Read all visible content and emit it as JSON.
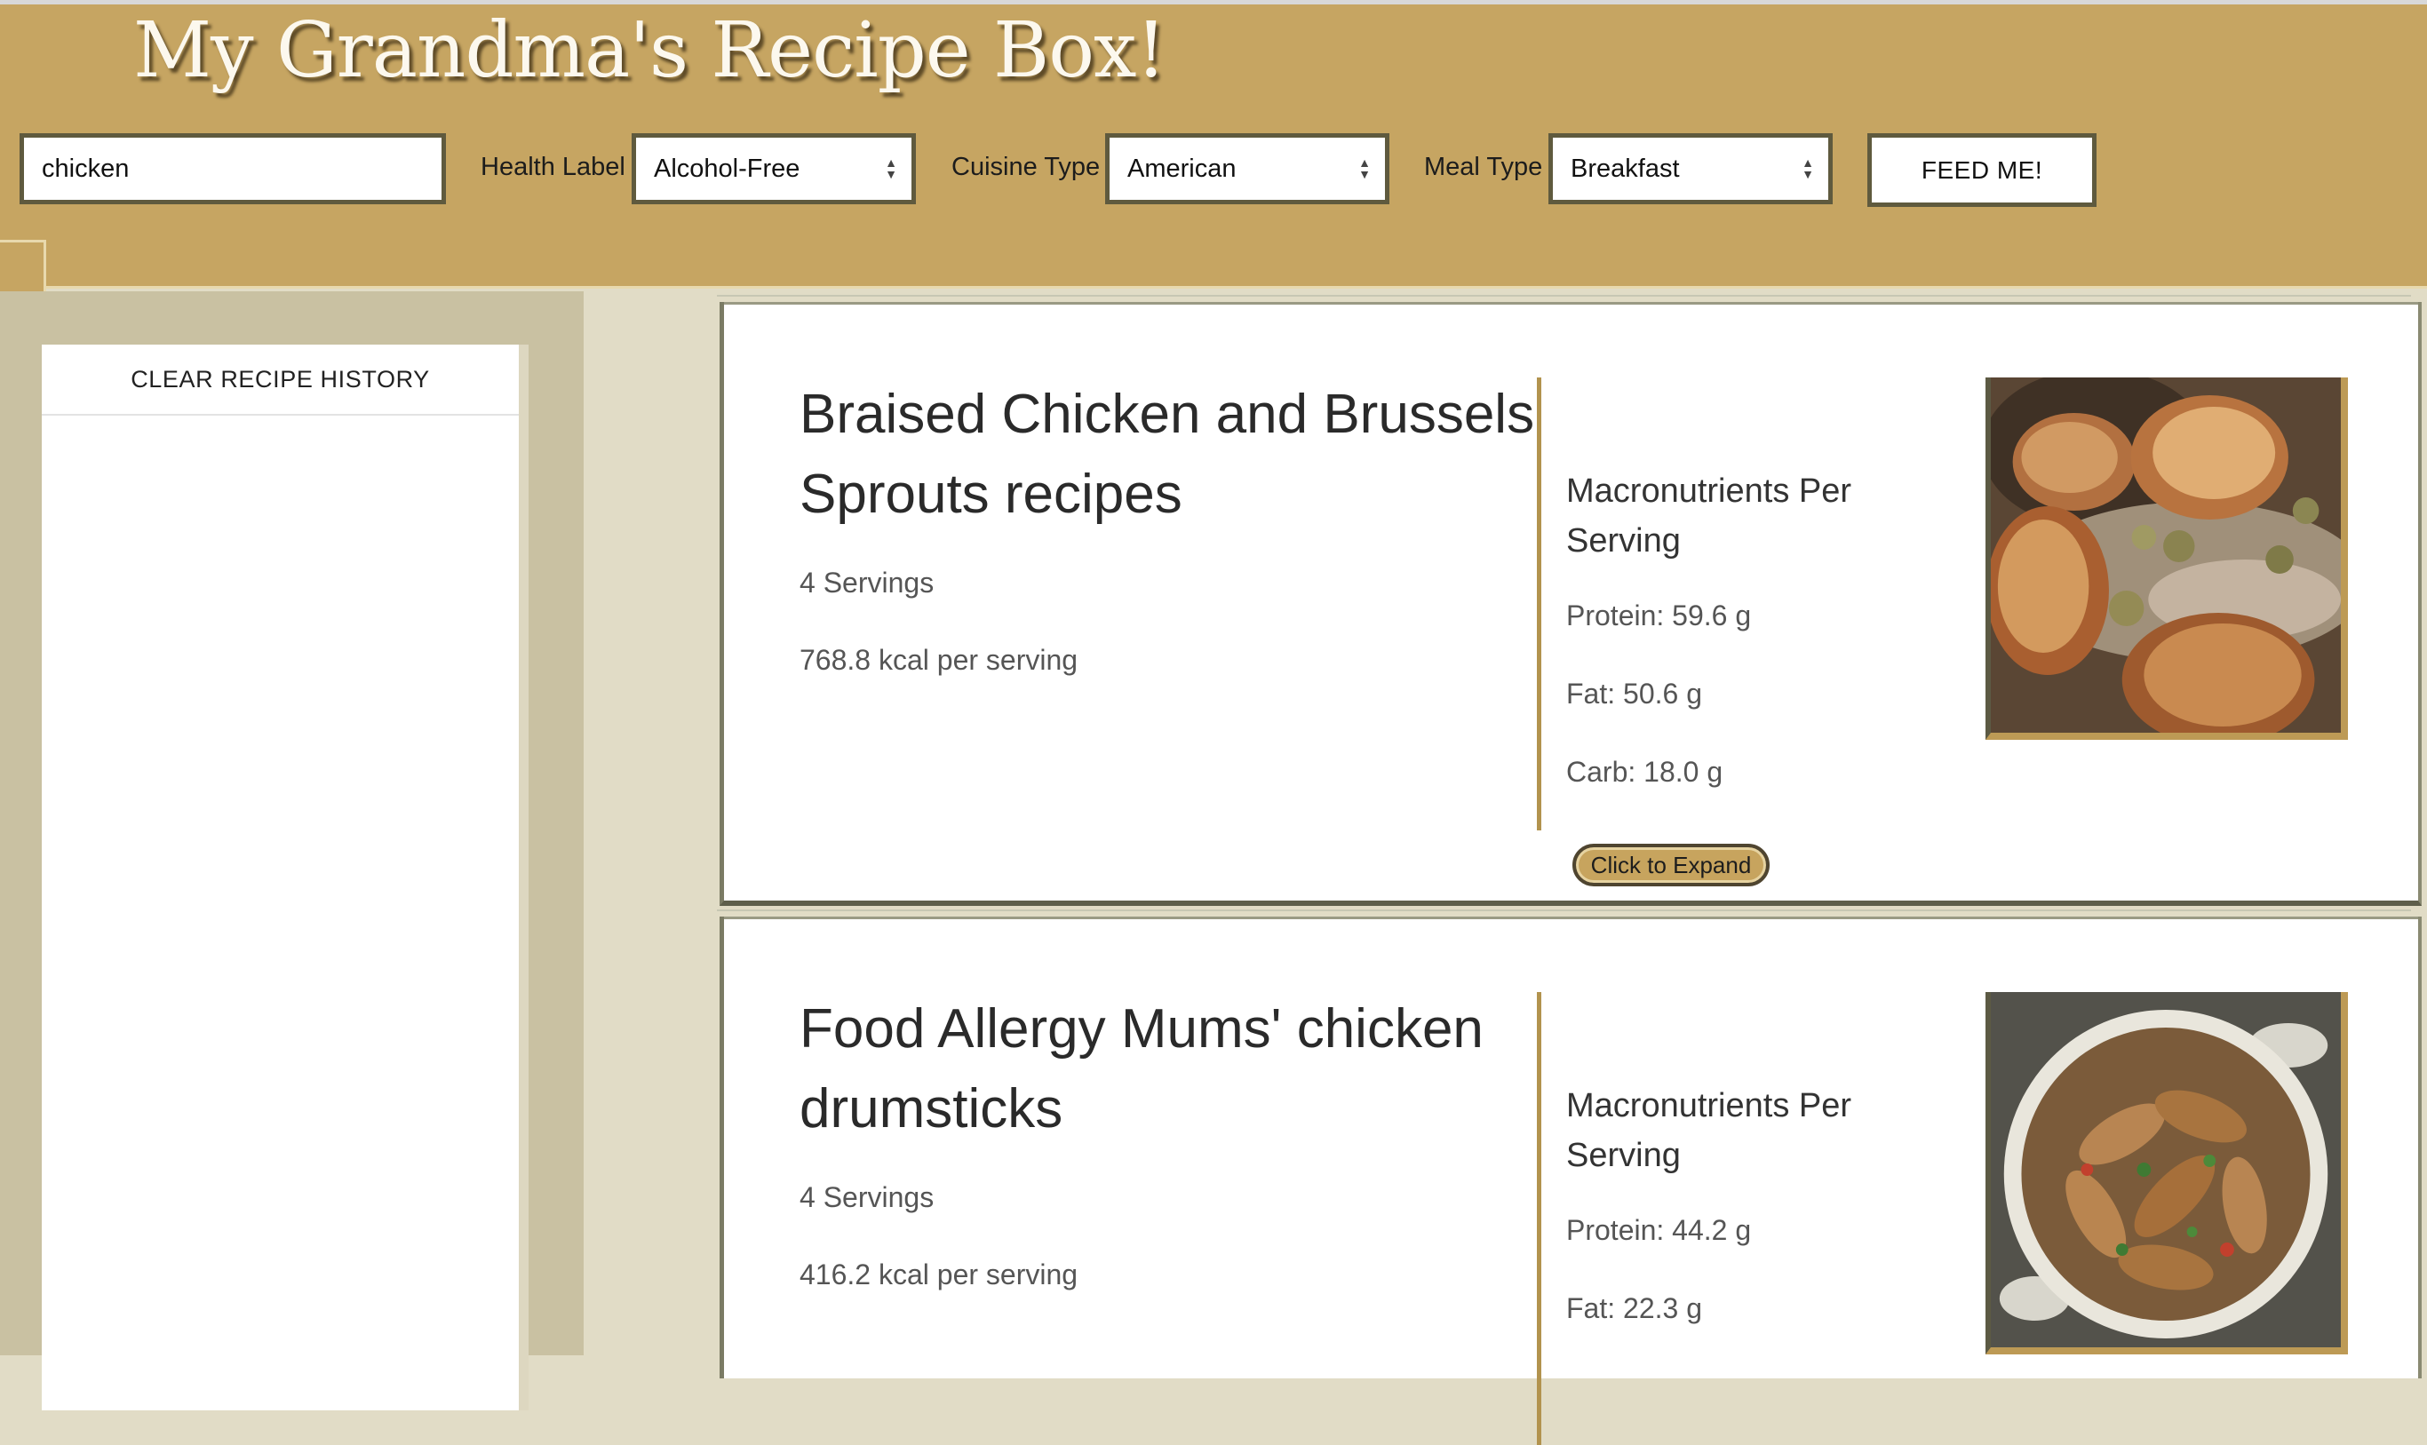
{
  "app": {
    "title": "My Grandma's Recipe Box!"
  },
  "search": {
    "value": "chicken",
    "placeholder": ""
  },
  "filters": {
    "health_label": "Health Label",
    "health_value": "Alcohol-Free",
    "cuisine_label": "Cuisine Type",
    "cuisine_value": "American",
    "meal_label": "Meal Type",
    "meal_value": "Breakfast"
  },
  "toolbar": {
    "feed_label": "FEED ME!"
  },
  "sidebar": {
    "clear_history_label": "CLEAR RECIPE HISTORY"
  },
  "recipes": [
    {
      "name": "Braised Chicken and Brussels Sprouts recipes",
      "servings": "4 Servings",
      "kcal": "768.8 kcal per serving",
      "macros_title": "Macronutrients Per Serving",
      "protein": "Protein: 59.6 g",
      "fat": "Fat: 50.6 g",
      "carb": "Carb: 18.0 g",
      "expand_label": "Click to Expand",
      "image_icon": "roasted-chicken-photo"
    },
    {
      "name": "Food Allergy Mums' chicken drumsticks",
      "servings": "4 Servings",
      "kcal": "416.2 kcal per serving",
      "macros_title": "Macronutrients Per Serving",
      "protein": "Protein: 44.2 g",
      "fat": "Fat: 22.3 g",
      "image_icon": "chicken-drumsticks-pan-photo"
    }
  ],
  "colors": {
    "header_bg": "#c6a562",
    "page_bg": "#e1dcc6",
    "sidebar_bg": "#c9c1a2",
    "accent_border": "#5f5a3e",
    "gold_accent": "#bd9a55"
  }
}
